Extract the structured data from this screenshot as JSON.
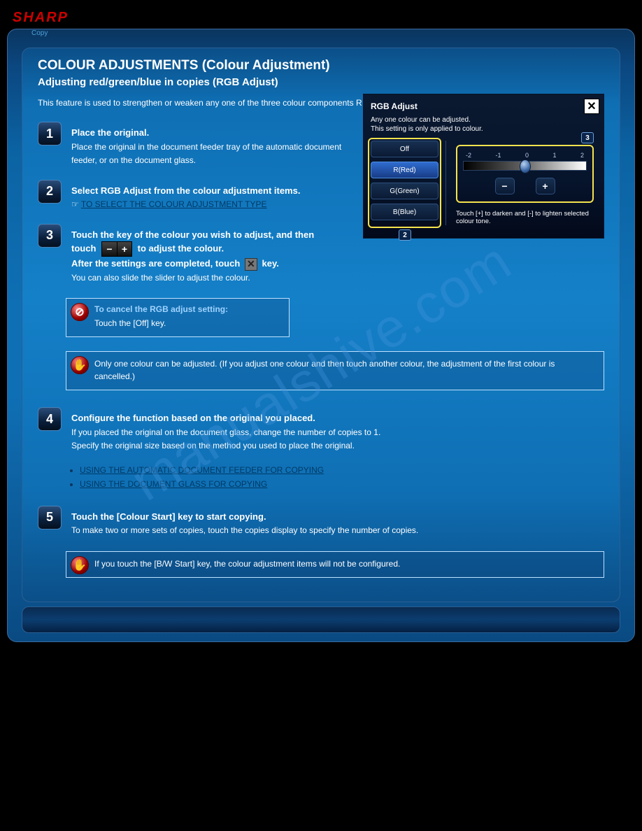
{
  "brand": "SHARP",
  "tab_label": "Copy",
  "header_sub": "",
  "title": "COLOUR ADJUSTMENTS (Colour Adjustment)",
  "subtitle": "Adjusting red/green/blue in copies (RGB Adjust)",
  "description": "This feature is used to strengthen or weaken any one of the three colour components R (red), G (green), or B (blue).",
  "steps": {
    "s1": "Place the original.",
    "s1_detail": "Place the original in the document feeder tray of the automatic document feeder, or on the document glass.",
    "s2": "Select RGB Adjust from the colour adjustment items.",
    "s2_link": "TO SELECT THE COLOUR ADJUSTMENT TYPE",
    "s3_a": "Touch the key of the colour you wish to adjust, and then touch",
    "s3_b": "to adjust the colour.",
    "s3_c": "After the settings are completed, touch",
    "s3_d": "key.",
    "s3_slider_note": "You can also slide the slider to adjust the colour.",
    "s4": "Configure the function based on the original you placed.",
    "s4_detail": "If you placed the original on the document glass, change the number of copies to 1.",
    "s4_detail2": "Specify the original size based on the method you used to place the original.",
    "s5": "Touch the [Colour Start] key to start copying.",
    "s5_detail": "To make two or more sets of copies, touch the copies display to specify the number of copies."
  },
  "links": {
    "feeder": "USING THE AUTOMATIC DOCUMENT FEEDER FOR COPYING",
    "glass": "USING THE DOCUMENT GLASS FOR COPYING"
  },
  "cancel_box": {
    "head": "To cancel the RGB adjust setting:",
    "body": "Touch the [Off] key."
  },
  "note_colour": {
    "body": "Only one colour can be adjusted. (If you adjust one colour and then touch another colour, the adjustment of the first colour is cancelled.)"
  },
  "note_bw": {
    "body": "If you touch the [B/W Start] key, the colour adjustment items will not be configured."
  },
  "ui": {
    "title": "RGB Adjust",
    "sub1": "Any one colour can be adjusted.",
    "sub2": "This setting is only applied to colour.",
    "opts": {
      "off": "Off",
      "r": "R(Red)",
      "g": "G(Green)",
      "b": "B(Blue)"
    },
    "ticks": {
      "m2": "-2",
      "m1": "-1",
      "z": "0",
      "p1": "1",
      "p2": "2"
    },
    "help": "Touch [+] to darken and [-] to lighten selected colour tone.",
    "badge2": "2",
    "badge3": "3"
  },
  "watermark": "manualshive.com"
}
